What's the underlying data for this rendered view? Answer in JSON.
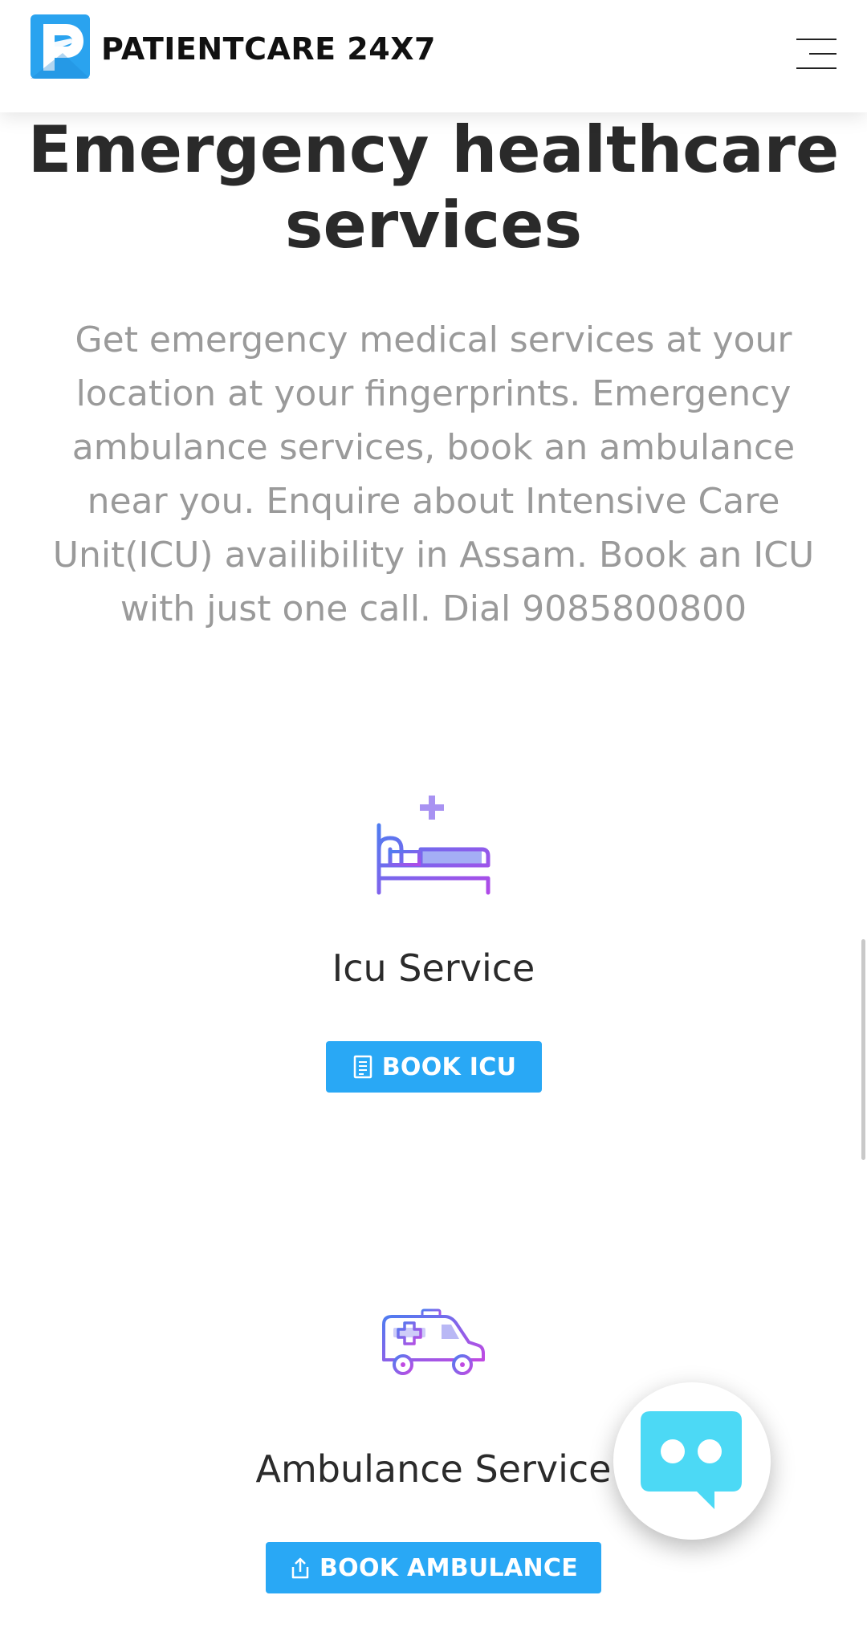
{
  "header": {
    "brand": "PATIENTCARE 24X7",
    "logo_icon": "patientcare-logo-icon",
    "menu_icon": "hamburger-menu-icon"
  },
  "hero": {
    "title": "Emergency healthcare services",
    "description": "Get emergency medical services at your location at your fingerprints. Emergency ambulance services, book an ambulance near you. Enquire about Intensive Care Unit(ICU) availibility in Assam. Book an ICU with just one call. Dial 9085800800"
  },
  "services": [
    {
      "icon": "hospital-bed-icon",
      "title": "Icu Service",
      "button_icon": "document-icon",
      "button_label": "BOOK ICU"
    },
    {
      "icon": "ambulance-icon",
      "title": "Ambulance Service",
      "button_icon": "share-icon",
      "button_label": "BOOK AMBULANCE"
    }
  ],
  "chat_widget": {
    "icon": "chat-bot-icon"
  },
  "colors": {
    "primary": "#29a8f5",
    "icon_gradient_start": "#4f7cf0",
    "icon_gradient_end": "#b04ae8",
    "chat_accent": "#4cd9f5",
    "body_text": "#9a9a9a",
    "heading_text": "#2a2a2a"
  }
}
